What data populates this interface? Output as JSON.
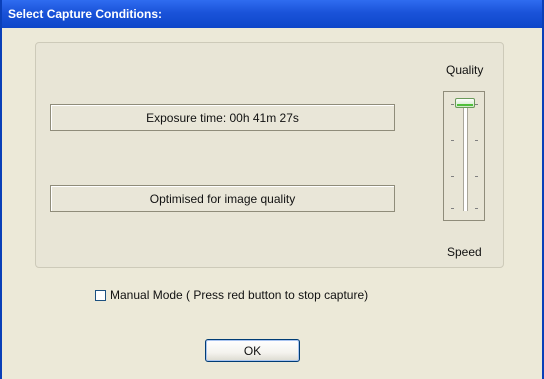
{
  "dialog": {
    "title": "Select  Capture Conditions:",
    "exposure_text": "Exposure time: 00h 41m 27s",
    "optimised_text": "Optimised for image quality",
    "slider": {
      "top_label": "Quality",
      "bottom_label": "Speed",
      "level": 1.0
    },
    "manual_mode": {
      "label": "Manual Mode ( Press red button to stop capture)",
      "checked": false
    },
    "ok_label": "OK"
  },
  "colors": {
    "title_bar": "#1a53d9",
    "dialog_bg": "#ece9d8",
    "slider_accent": "#4fbf3a"
  }
}
